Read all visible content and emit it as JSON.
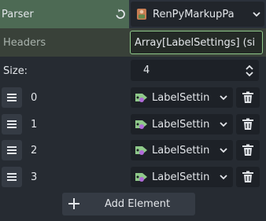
{
  "parser": {
    "label": "Parser",
    "value": "RenPyMarkupPa",
    "revert_icon": "revert-icon",
    "script_icon": "script-icon",
    "dropdown_icon": "chevron-down-icon"
  },
  "headers": {
    "label": "Headers",
    "value": "Array[LabelSettings] (si"
  },
  "array": {
    "size_label": "Size:",
    "size_value": "4",
    "items": [
      {
        "index": "0",
        "value": "LabelSettin"
      },
      {
        "index": "1",
        "value": "LabelSettin"
      },
      {
        "index": "2",
        "value": "LabelSettin"
      },
      {
        "index": "3",
        "value": "LabelSettin"
      }
    ],
    "drag_icon": "drag-handle-icon",
    "resource_icon": "label-settings-icon",
    "delete_icon": "trash-icon",
    "add_button_label": "Add Element",
    "add_icon": "plus-icon"
  },
  "colors": {
    "accent_green": "#8fc98a",
    "selected_row": "#4d6a54",
    "panel_bg": "#262b32"
  }
}
